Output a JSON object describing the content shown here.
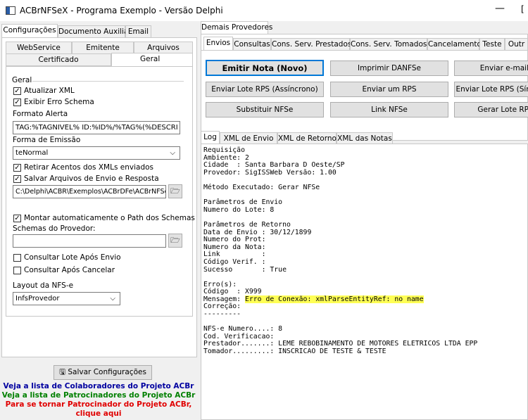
{
  "window": {
    "title": "ACBrNFSeX - Programa Exemplo - Versão Delphi",
    "min": "—",
    "max": "["
  },
  "left": {
    "tabs": [
      "Configurações",
      "Documento Auxiliar",
      "Email"
    ],
    "subtabs_row1": [
      "WebService",
      "Emitente",
      "Arquivos"
    ],
    "subtabs_row2": [
      "Certificado",
      "Geral"
    ],
    "geral_title": "Geral",
    "atualizar_xml": "Atualizar XML",
    "exibir_erro": "Exibir Erro Schema",
    "formato_alerta_label": "Formato Alerta",
    "formato_alerta_value": "TAG:%TAGNIVEL% ID:%ID%/%TAG%(%DESCRI",
    "forma_emissao_label": "Forma de Emissão",
    "forma_emissao_value": "teNormal",
    "retirar_acentos": "Retirar Acentos dos XMLs enviados",
    "salvar_arquivos": "Salvar Arquivos de Envio e Resposta",
    "path_value": "C:\\Delphi\\ACBR\\Exemplos\\ACBrDFe\\ACBrNFSe",
    "montar_path": "Montar automaticamente o Path dos Schemas",
    "schemas_label": "Schemas do Provedor:",
    "schemas_value": "",
    "consultar_lote": "Consultar Lote Após Envio",
    "consultar_cancelar": "Consultar Após Cancelar",
    "layout_label": "Layout da NFS-e",
    "layout_value": "InfsProvedor",
    "salvar_btn": "Salvar Configurações",
    "link1": "Veja a lista de Colaboradores do Projeto ACBr",
    "link2": "Veja a lista de Patrocinadores do Projeto ACBr",
    "link3a": "Para se tornar Patrocinador do Projeto ACBr,",
    "link3b": "clique aqui"
  },
  "right": {
    "top_tab": "Demais Provedores",
    "tabs": [
      "Envios",
      "Consultas",
      "Cons. Serv. Prestados",
      "Cons. Serv. Tomados",
      "Cancelamento",
      "Teste",
      "Outr"
    ],
    "buttons": [
      "Emitir Nota (Novo)",
      "Imprimir DANFSe",
      "Enviar e-mail",
      "Enviar Lote RPS (Assíncrono)",
      "Enviar um RPS",
      "Enviar Lote RPS (Sín",
      "Substituir NFSe",
      "Link NFSe",
      "Gerar Lote RP"
    ],
    "log_tabs": [
      "Log",
      "XML de Envio",
      "XML de Retorno",
      "XML das Notas"
    ],
    "log_before": "Requisição\nAmbiente: 2\nCidade  : Santa Barbara D Oeste/SP\nProvedor: SigISSWeb Versão: 1.00\n\nMétodo Executado: Gerar NFSe\n\nParâmetros de Envio\nNumero do Lote: 8\n\nParâmetros de Retorno\nData de Envio : 30/12/1899\nNumero do Prot:\nNumero da Nota:\nLink          :\nCódigo Verif. :\nSucesso       : True\n\nErro(s):\nCódigo  : X999\nMensagem: ",
    "log_highlight": "Erro de Conexão: xmlParseEntityRef: no name",
    "log_after": "\nCorreção:\n---------\n\nNFS-e Numero....: 8\nCod. Verificacao:\nPrestador.......: LEME REBOBINAMENTO DE MOTORES ELETRICOS LTDA EPP\nTomador.........: INSCRICAO DE TESTE & TESTE"
  },
  "colors": {
    "link_blue": "#0000a0",
    "link_green": "#008000",
    "link_red": "#e00000",
    "highlight": "#ffff55"
  }
}
